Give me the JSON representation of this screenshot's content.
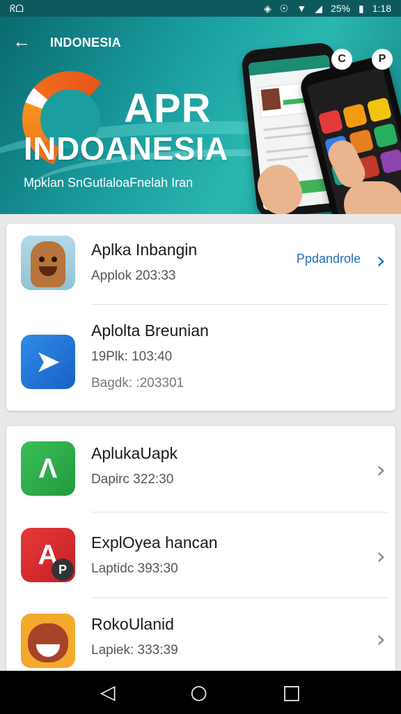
{
  "status_bar": {
    "left_glyph": "ᖇᗝ",
    "battery_text": "25%",
    "time": "1:18"
  },
  "header": {
    "back_icon": "arrow-left-icon",
    "label": "INDONESIA",
    "title_line1": "APR",
    "title_line2": "INDOANESIA",
    "subtitle": "Mpklan SnGutlaloaFnelah Iran",
    "badge_a": "C",
    "badge_b": "P"
  },
  "card1": {
    "items": [
      {
        "name": "Aplka Inbangin",
        "meta": "Applok 203:33",
        "link_label": "Ppdandrole",
        "icon": "wooden-totem-icon"
      },
      {
        "name": "Aplolta Breunian",
        "meta": "19Plk: 103:40",
        "meta2": "Bagdk: :203301",
        "icon": "blue-arrow-icon"
      }
    ]
  },
  "card2": {
    "items": [
      {
        "name": "AplukaUapk",
        "meta": "Dapirc 322:30",
        "icon": "green-arrow-icon"
      },
      {
        "name": "ExplOyea hancan",
        "meta": "Laptidc 393:30",
        "icon": "red-a-icon",
        "badge": "P"
      },
      {
        "name": "RokoUlanid",
        "meta": "Lapiek: 333:39",
        "icon": "fox-face-icon"
      }
    ]
  },
  "colors": {
    "hero_teal": "#1a9ea0",
    "accent_blue": "#1f6fb8",
    "logo_orange": "#f26b1d"
  }
}
